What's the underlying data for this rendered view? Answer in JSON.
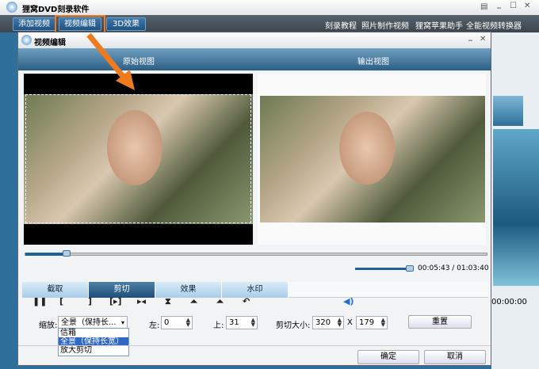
{
  "app": {
    "title": "狸窝DVD刻录软件",
    "window_controls": [
      "menu",
      "minimize",
      "maximize",
      "close"
    ]
  },
  "toolbar": {
    "buttons": [
      "添加视频",
      "视频编辑",
      "3D效果"
    ],
    "links": [
      "刻录教程",
      "照片制作视频",
      "狸窝苹果助手",
      "全能视频转换器"
    ]
  },
  "dialog": {
    "title": "视频编辑",
    "views": {
      "original": "原始视图",
      "output": "输出视图"
    },
    "time": "00:05:43 / 01:03:40",
    "playhead_fraction": 0.09,
    "volume_fraction": 0.95,
    "tabs": [
      "截取",
      "剪切",
      "效果",
      "水印"
    ],
    "active_tab": "剪切",
    "crop": {
      "zoom_label": "缩放:",
      "zoom_value": "全景（保持长...",
      "options": [
        "信箱",
        "全景（保持长宽）",
        "放大剪切"
      ],
      "selected_option": "全景（保持长宽）",
      "left_label": "左:",
      "left": "0",
      "top_label": "上:",
      "top": "31",
      "size_label": "剪切大小:",
      "width": "320",
      "x": "X",
      "height": "179",
      "reset": "重置"
    },
    "ok": "确定",
    "cancel": "取消"
  },
  "background": {
    "time": "00:00:00"
  },
  "colors": {
    "highlight": "#f07a1e",
    "accent": "#1f5384"
  }
}
